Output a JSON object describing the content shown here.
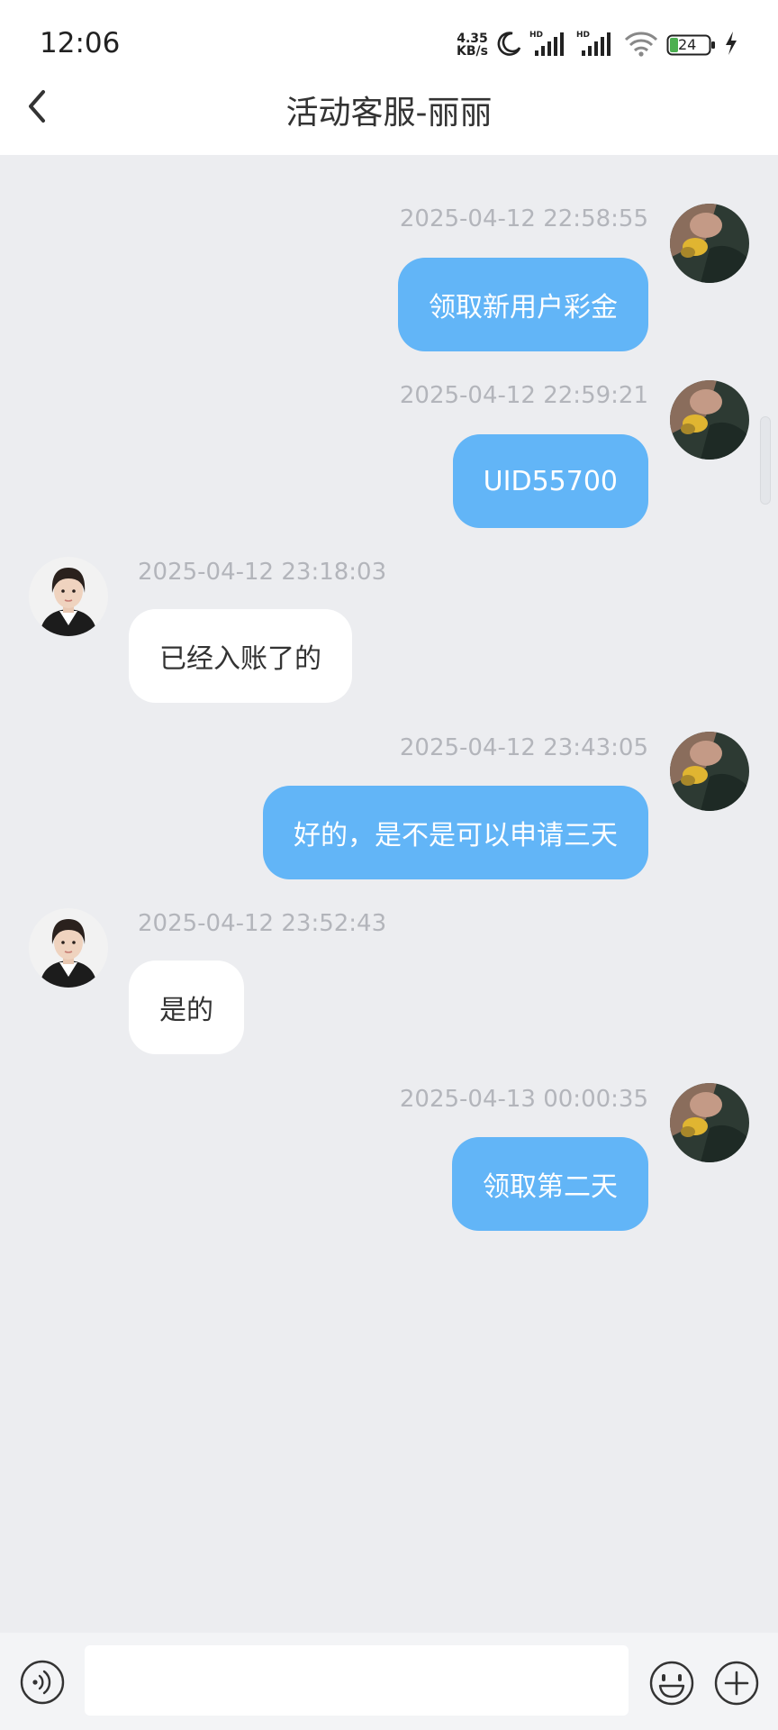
{
  "status_bar": {
    "time": "12:06",
    "net_speed_value": "4.35",
    "net_speed_unit": "KB/s",
    "battery_level": "24",
    "icons": [
      "moon-icon",
      "hd-signal-icon",
      "hd-signal-icon",
      "wifi-icon",
      "battery-icon",
      "charging-icon"
    ]
  },
  "header": {
    "title": "活动客服-丽丽"
  },
  "messages": [
    {
      "from": "me",
      "timestamp": "2025-04-12 22:58:55",
      "text": "领取新用户彩金"
    },
    {
      "from": "me",
      "timestamp": "2025-04-12 22:59:21",
      "text": "UID55700"
    },
    {
      "from": "agent",
      "timestamp": "2025-04-12 23:18:03",
      "text": "已经入账了的"
    },
    {
      "from": "me",
      "timestamp": "2025-04-12 23:43:05",
      "text": "好的，是不是可以申请三天"
    },
    {
      "from": "agent",
      "timestamp": "2025-04-12 23:52:43",
      "text": "是的"
    },
    {
      "from": "me",
      "timestamp": "2025-04-13 00:00:35",
      "text": "领取第二天"
    }
  ],
  "input_bar": {
    "value": "",
    "placeholder": ""
  },
  "colors": {
    "background": "#ecedf0",
    "my_bubble": "#62b5f7",
    "agent_bubble": "#ffffff",
    "timestamp": "#b3b5bb",
    "battery_fill": "#4caf50"
  }
}
